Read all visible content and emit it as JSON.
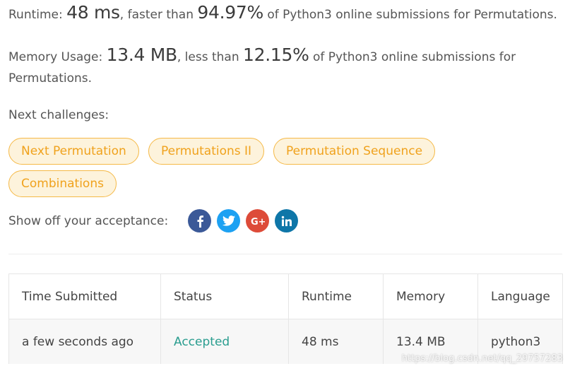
{
  "stats": {
    "runtime_prefix": "Runtime: ",
    "runtime_value": "48 ms",
    "runtime_mid": ", faster than ",
    "runtime_percent": "94.97%",
    "runtime_suffix": " of Python3 online submissions for Permutations.",
    "memory_prefix": "Memory Usage: ",
    "memory_value": "13.4 MB",
    "memory_mid": ", less than ",
    "memory_percent": "12.15%",
    "memory_suffix": " of Python3 online submissions for Permutations."
  },
  "next": {
    "label": "Next challenges:",
    "chips": [
      "Next Permutation",
      "Permutations II",
      "Permutation Sequence",
      "Combinations"
    ]
  },
  "share": {
    "label": "Show off your acceptance:",
    "icons": [
      "facebook-icon",
      "twitter-icon",
      "google-plus-icon",
      "linkedin-icon"
    ],
    "colors": {
      "facebook": "#3b5998",
      "twitter": "#1da1f2",
      "google_plus": "#dd4b39",
      "linkedin": "#0e76a8"
    }
  },
  "table": {
    "headers": [
      "Time Submitted",
      "Status",
      "Runtime",
      "Memory",
      "Language"
    ],
    "row": [
      "a few seconds ago",
      "Accepted",
      "48 ms",
      "13.4 MB",
      "python3"
    ]
  },
  "colors": {
    "chip_border": "#f5b947",
    "chip_bg": "#fdf3dc",
    "chip_text": "#f0a21d",
    "accepted": "#2a9d8f"
  },
  "watermark": "https://blog.csdn.net/qq_29757283"
}
